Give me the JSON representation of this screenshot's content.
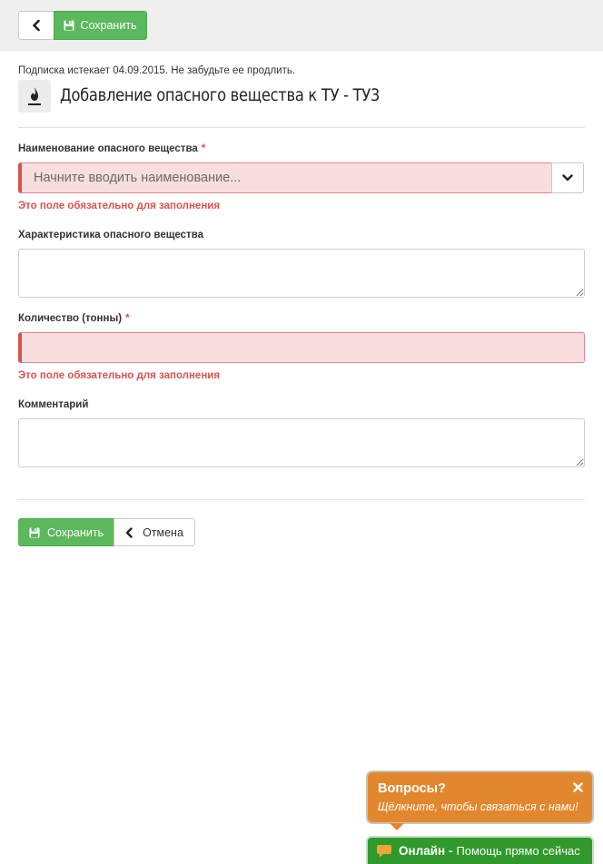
{
  "toolbar": {
    "back_icon": "chevron-left-icon",
    "save_icon": "floppy-disk-icon",
    "save_label": "Сохранить"
  },
  "notice": "Подписка истекает 04.09.2015. Не забудьте ее продлить.",
  "header": {
    "icon": "flame-icon",
    "title": "Добавление опасного вещества к ТУ - ТУ3"
  },
  "form": {
    "substance_name": {
      "label": "Наименование опасного вещества",
      "required_mark": "*",
      "placeholder": "Начните вводить наименование...",
      "toggle_icon": "chevron-down-icon",
      "error": "Это поле обязательно для заполнения"
    },
    "characteristic": {
      "label": "Характеристика опасного вещества",
      "value": ""
    },
    "quantity": {
      "label": "Количество (тонны)",
      "required_mark": "*",
      "value": "",
      "error": "Это поле обязательно для заполнения"
    },
    "comment": {
      "label": "Комментарий",
      "value": ""
    }
  },
  "actions": {
    "save_label": "Сохранить",
    "cancel_label": "Отмена"
  },
  "chat": {
    "title": "Вопросы?",
    "subtitle": "Щёлкните, чтобы связаться с нами!",
    "close_icon": "close-icon",
    "online_label": "Онлайн -",
    "help_text": "Помощь прямо сейчас",
    "chat_icon": "speech-bubble-icon"
  },
  "colors": {
    "success": "#5cb85c",
    "danger": "#d9534f",
    "error_bg": "#f8dede",
    "chat_orange": "#e3872f",
    "chat_green": "#2f9a2b"
  }
}
